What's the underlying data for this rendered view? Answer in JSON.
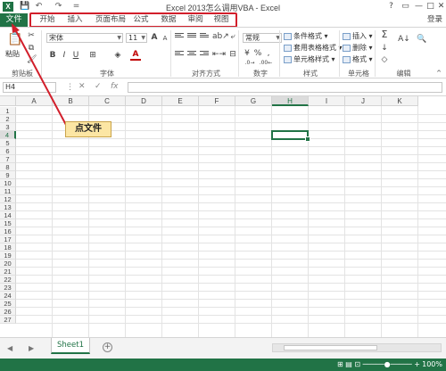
{
  "window": {
    "title": "Excel 2013怎么调用VBA - Excel",
    "app_icon": "X",
    "help": "?",
    "minimize": "—",
    "restore": "□",
    "close": "✕"
  },
  "qat": {
    "save": "💾",
    "undo": "↶",
    "redo": "↷",
    "customize": "="
  },
  "tabs": {
    "file": "文件",
    "items": [
      "开始",
      "插入",
      "页面布局",
      "公式",
      "数据",
      "审阅",
      "视图"
    ],
    "login": "登录",
    "highlight_color": "#d21f2b"
  },
  "ribbon": {
    "clipboard": {
      "paste": "粘贴",
      "label": "剪贴板"
    },
    "font": {
      "name": "宋体",
      "size": "11",
      "bold": "B",
      "italic": "I",
      "underline": "U",
      "grow": "A",
      "shrink": "A",
      "color_letter": "A",
      "label": "字体"
    },
    "alignment": {
      "label": "对齐方式"
    },
    "number": {
      "format": "常规",
      "percent": "%",
      "comma": ",",
      "label": "数字"
    },
    "styles": {
      "conditional": "条件格式",
      "table": "套用表格格式",
      "cell": "单元格样式",
      "label": "样式"
    },
    "cells": {
      "insert": "插入",
      "delete": "删除",
      "format": "格式",
      "label": "单元格"
    },
    "editing": {
      "sum": "Σ",
      "fill": "↓",
      "clear": "◇",
      "sort": "A↓",
      "find": "🔍",
      "label": "编辑"
    }
  },
  "formula": {
    "name_box": "H4",
    "cancel": "✕",
    "enter": "✓",
    "fx": "fx",
    "value": ""
  },
  "grid": {
    "columns": [
      "A",
      "B",
      "C",
      "D",
      "E",
      "F",
      "G",
      "H",
      "I",
      "J",
      "K"
    ],
    "rows": [
      "1",
      "2",
      "3",
      "4",
      "5",
      "6",
      "7",
      "8",
      "9",
      "10",
      "11",
      "12",
      "13",
      "14",
      "15",
      "16",
      "17",
      "18",
      "19",
      "20",
      "21",
      "22",
      "23",
      "24",
      "25",
      "26",
      "27"
    ],
    "selected_column": "H",
    "selected_row": "4"
  },
  "annotation": {
    "text": "点文件",
    "arrow_color": "#d21f2b"
  },
  "sheets": {
    "tabs": [
      "Sheet1"
    ],
    "add": "+",
    "prev": "◀",
    "next": "▶"
  },
  "status": {
    "ready": "",
    "zoom": "100%",
    "accent": "#217346"
  }
}
